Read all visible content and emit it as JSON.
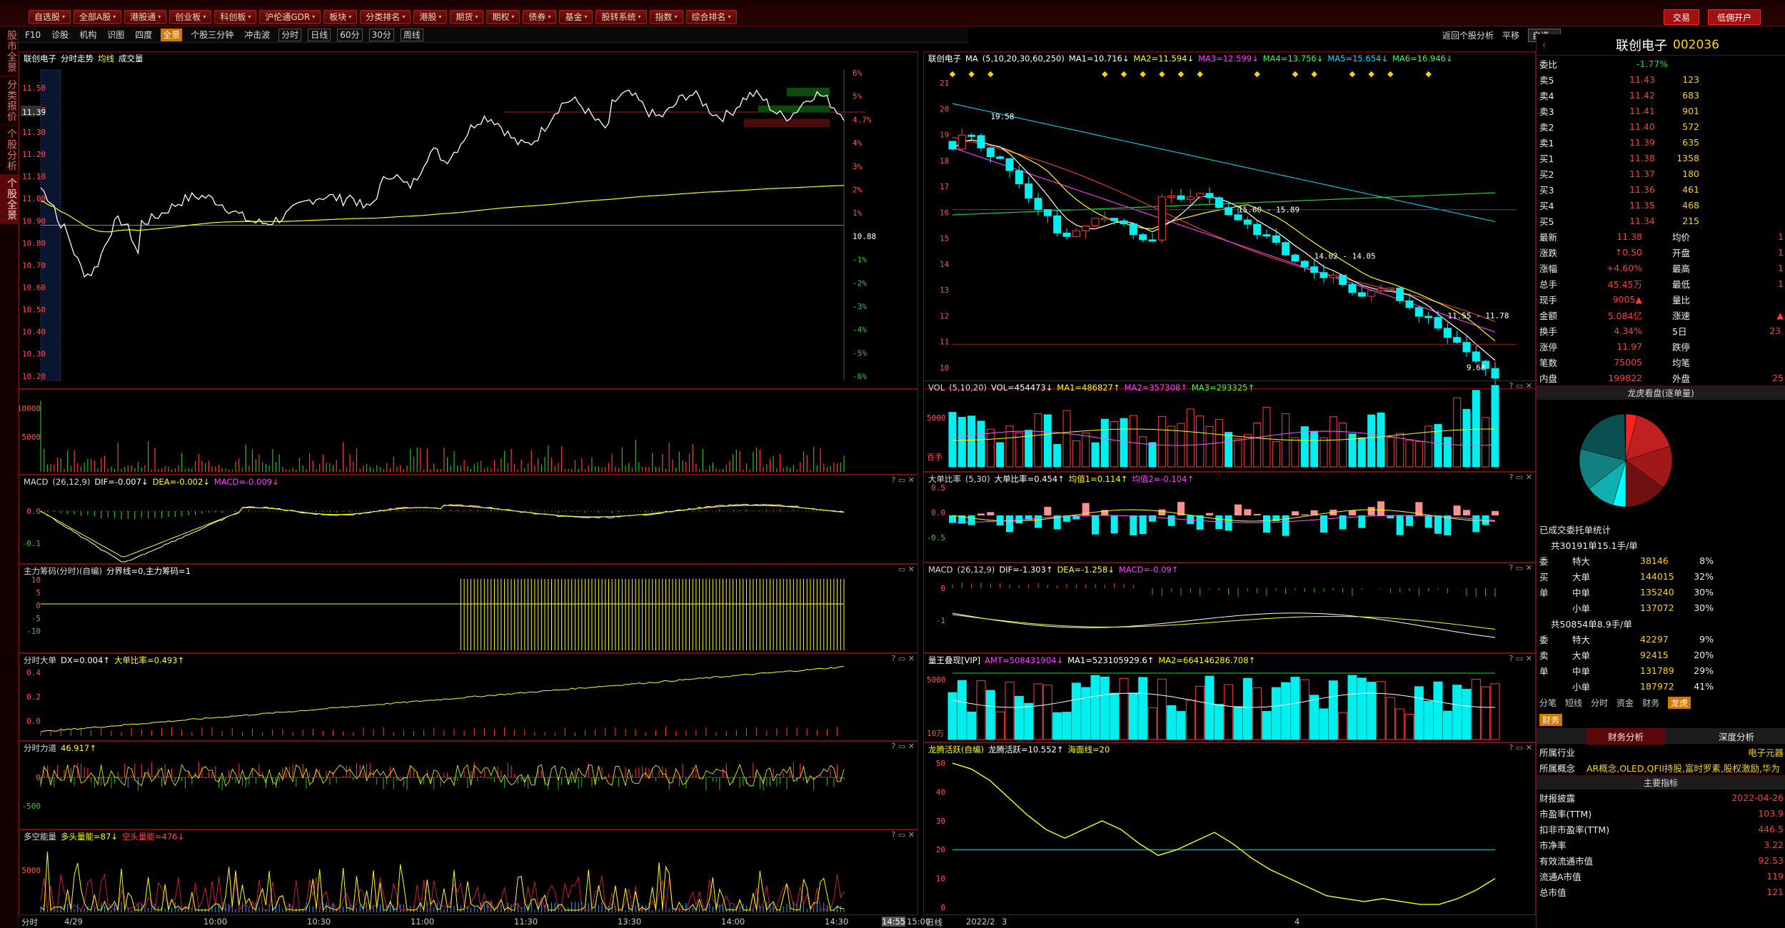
{
  "toolbar": {
    "items": [
      "自选股",
      "全部A股",
      "港股通",
      "创业板",
      "科创板",
      "沪伦通GDR",
      "板块",
      "分类排名",
      "港股",
      "期货",
      "期权",
      "债券",
      "基金",
      "股转系统",
      "指数",
      "综合排名"
    ],
    "trade": "交易",
    "open_account": "低佣开户"
  },
  "side_tabs": [
    "股市全景",
    "分类报价",
    "个股分析",
    "个股全景"
  ],
  "sub_tabs": [
    "F10",
    "诊股",
    "机构",
    "识图",
    "四度",
    "全景",
    "个股三分钟",
    "冲击波",
    "分时",
    "日线",
    "60分",
    "30分",
    "周线"
  ],
  "right_cmds": {
    "back": "返回个股分析",
    "flat": "平移",
    "self": "自选"
  },
  "intraday": {
    "name": "联创电子",
    "period": "分时走势",
    "avg": "均线",
    "vol": "成交量",
    "price_ticks": [
      "11.50",
      "11.40",
      "11.39",
      "11.30",
      "11.20",
      "11.10",
      "11.00",
      "10.90",
      "10.80",
      "10.70",
      "10.60",
      "10.50",
      "10.40",
      "10.30",
      "10.20"
    ],
    "pct_ticks": [
      "6%",
      "5%",
      "4.7%",
      "4%",
      "3%",
      "2%",
      "1%",
      "10.88",
      "-1%",
      "-2%",
      "-3%",
      "-4%",
      "-5%",
      "-6%"
    ],
    "vol_ticks": [
      "10000",
      "5000"
    ],
    "macd_hdr": {
      "name": "MACD",
      "params": "(26,12,9)",
      "dif": "DIF=-0.007↓",
      "dea": "DEA=-0.002↓",
      "macd": "MACD=-0.009↓"
    },
    "macd_ticks": [
      "0.0",
      "-0.1"
    ],
    "zl_hdr": {
      "name": "主力筹码(分时)(自编)",
      "line": "分界线=0,主力筹码=1"
    },
    "zl_ticks": [
      "10",
      "5",
      "0",
      "-5",
      "-10"
    ],
    "dd_hdr": {
      "name": "分时大单",
      "dx": "DX=0.004↑",
      "ratio": "大单比率=0.493↑"
    },
    "dd_ticks": [
      "0.4",
      "0.2",
      "0.0"
    ],
    "ld_hdr": {
      "name": "分时力道",
      "val": "46.917↑"
    },
    "ld_ticks": [
      "0",
      "-500"
    ],
    "dk_hdr": {
      "name": "多空能量",
      "bull": "多头量能=87↓",
      "bear": "空头量能=476↓"
    },
    "dk_ticks": [
      "5000"
    ],
    "x_labels": [
      "分时",
      "4/29",
      "10:00",
      "10:30",
      "11:00",
      "11:30",
      "13:30",
      "14:00",
      "14:30",
      "14:55",
      "15:00"
    ]
  },
  "daily": {
    "name": "联创电子",
    "ma": "MA",
    "params": "(5,10,20,30,60,250)",
    "ma1": "MA1=10.716↓",
    "ma2": "MA2=11.594↓",
    "ma3": "MA3=12.599↓",
    "ma4": "MA4=13.756↓",
    "ma5": "MA5=15.654↓",
    "ma6": "MA6=16.946↓",
    "y_ticks": [
      "21",
      "20",
      "19",
      "18",
      "17",
      "16",
      "15",
      "14",
      "13",
      "12",
      "11",
      "10"
    ],
    "annots": [
      "19.58",
      "15.60 - 15.89",
      "14.02 - 14.05",
      "11.55 - 11.78",
      "9.68"
    ],
    "vol_hdr": {
      "name": "VOL",
      "params": "(5,10,20)",
      "vol": "VOL=454473↓",
      "ma1": "MA1=486827↑",
      "ma2": "MA2=357308↑",
      "ma3": "MA3=293325↑"
    },
    "vol_ticks": [
      "5000",
      "百手"
    ],
    "dd_hdr": {
      "name": "大单比率",
      "params": "(5,30)",
      "v": "大单比率=0.454↑",
      "a1": "均值1=0.114↑",
      "a2": "均值2=-0.104↑"
    },
    "dd_ticks": [
      "0.5",
      "0.0",
      "-0.5"
    ],
    "macd_hdr": {
      "name": "MACD",
      "params": "(26,12,9)",
      "dif": "DIF=-1.303↑",
      "dea": "DEA=-1.258↓",
      "macd": "MACD=-0.09↑"
    },
    "macd_ticks": [
      "0",
      "-1"
    ],
    "lw_hdr": {
      "name": "量王叠现[VIP]",
      "amt": "AMT=508431904↓",
      "ma1": "MA1=523105929.6↑",
      "ma2": "MA2=664146286.708↑"
    },
    "lw_ticks": [
      "5000",
      "10万"
    ],
    "lt_hdr": {
      "name": "龙腾活跃(自编)",
      "v": "龙腾活跃=10.552↑",
      "sea": "海面线=20"
    },
    "lt_ticks": [
      "50",
      "40",
      "30",
      "20",
      "10",
      "0"
    ],
    "x_labels": [
      "日线",
      "2022/2",
      "3",
      "4"
    ]
  },
  "quote": {
    "name": "联创电子",
    "code": "002036",
    "weibi_label": "委比",
    "weibi": "-1.77%",
    "asks": [
      {
        "l": "卖5",
        "p": "11.43",
        "v": "123"
      },
      {
        "l": "卖4",
        "p": "11.42",
        "v": "683"
      },
      {
        "l": "卖3",
        "p": "11.41",
        "v": "901"
      },
      {
        "l": "卖2",
        "p": "11.40",
        "v": "572"
      },
      {
        "l": "卖1",
        "p": "11.39",
        "v": "635"
      }
    ],
    "bids": [
      {
        "l": "买1",
        "p": "11.38",
        "v": "1358"
      },
      {
        "l": "买2",
        "p": "11.37",
        "v": "180"
      },
      {
        "l": "买3",
        "p": "11.36",
        "v": "461"
      },
      {
        "l": "买4",
        "p": "11.35",
        "v": "468"
      },
      {
        "l": "买5",
        "p": "11.34",
        "v": "215"
      }
    ],
    "stats": [
      {
        "a": "最新",
        "b": "11.38",
        "c": "均价",
        "d": "1"
      },
      {
        "a": "涨跌",
        "b": "↑0.50",
        "c": "开盘",
        "d": "1"
      },
      {
        "a": "涨幅",
        "b": "+4.60%",
        "c": "最高",
        "d": "1"
      },
      {
        "a": "总手",
        "b": "45.45万",
        "c": "最低",
        "d": "1"
      },
      {
        "a": "现手",
        "b": "9005▲",
        "c": "量比",
        "d": ""
      },
      {
        "a": "金额",
        "b": "5.084亿",
        "c": "涨速",
        "d": "▲"
      },
      {
        "a": "换手",
        "b": "4.34%",
        "c": "5日",
        "d": "23."
      },
      {
        "a": "涨停",
        "b": "11.97",
        "c": "跌停",
        "d": ""
      },
      {
        "a": "笔数",
        "b": "75005",
        "c": "均笔",
        "d": ""
      },
      {
        "a": "内盘",
        "b": "199822",
        "c": "外盘",
        "d": "25"
      }
    ],
    "lhk_title": "龙虎看盘(逐单量)",
    "orders_title": "已成交委托单统计",
    "buy_total": "共30191单15.1手/单",
    "buy": [
      {
        "l": "特大",
        "v": "38146",
        "p": "8%"
      },
      {
        "l": "大单",
        "v": "144015",
        "p": "32%"
      },
      {
        "l": "中单",
        "v": "135240",
        "p": "30%"
      },
      {
        "l": "小单",
        "v": "137072",
        "p": "30%"
      }
    ],
    "sell_total": "共50854单8.9手/单",
    "sell": [
      {
        "l": "特大",
        "v": "42297",
        "p": "9%"
      },
      {
        "l": "大单",
        "v": "92415",
        "p": "20%"
      },
      {
        "l": "中单",
        "v": "131789",
        "p": "29%"
      },
      {
        "l": "小单",
        "v": "187972",
        "p": "41%"
      }
    ],
    "side_buy": [
      "委",
      "买",
      "单"
    ],
    "side_sell": [
      "委",
      "卖",
      "单"
    ],
    "tabs": [
      "分笔",
      "短线",
      "分时",
      "资金",
      "财务",
      "龙虎"
    ],
    "fin_tab": "财务",
    "fin_sub": [
      "财务分析",
      "深度分析"
    ],
    "industry_label": "所属行业",
    "industry": "电子元器",
    "concept_label": "所属概念",
    "concept": "AR概念,OLED,QFII持股,富时罗素,股权激励,华为",
    "main_title": "主要指标",
    "fin": [
      {
        "a": "财报披露",
        "b": "2022-04-26"
      },
      {
        "a": "市盈率(TTM)",
        "b": "103.9"
      },
      {
        "a": "扣非市盈率(TTM)",
        "b": "446.5"
      },
      {
        "a": "市净率",
        "b": "3.22"
      },
      {
        "a": "有效流通市值",
        "b": "92.53"
      },
      {
        "a": "流通A市值",
        "b": "119"
      },
      {
        "a": "总市值",
        "b": "121"
      }
    ]
  },
  "colors": {
    "up": "#ff3b3b",
    "down": "#00f0f0",
    "price": "#ffffff",
    "avg": "#ffff00"
  }
}
